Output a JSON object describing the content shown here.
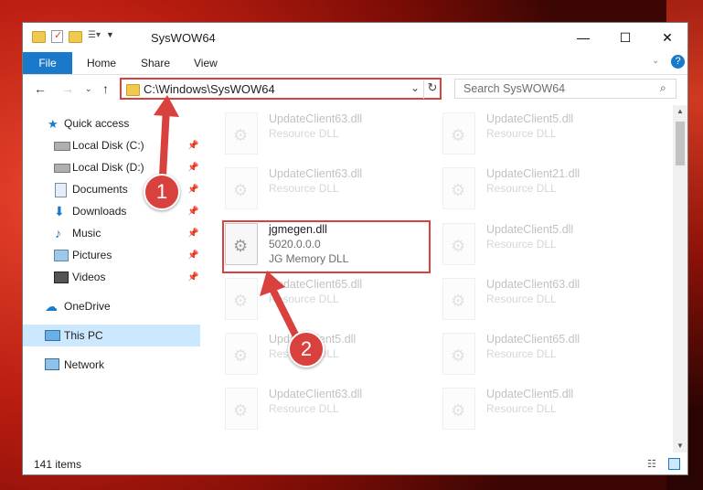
{
  "window": {
    "title": "SysWOW64"
  },
  "ribbon": {
    "tabs": [
      "File",
      "Home",
      "Share",
      "View"
    ]
  },
  "address": {
    "path": "C:\\Windows\\SysWOW64"
  },
  "search": {
    "placeholder": "Search SysWOW64"
  },
  "sidebar": {
    "items": [
      {
        "label": "Quick access",
        "icon": "star-icon"
      },
      {
        "label": "Local Disk (C:)",
        "icon": "drive-icon"
      },
      {
        "label": "Local Disk (D:)",
        "icon": "drive-icon"
      },
      {
        "label": "Documents",
        "icon": "documents-icon"
      },
      {
        "label": "Downloads",
        "icon": "download-icon"
      },
      {
        "label": "Music",
        "icon": "music-icon"
      },
      {
        "label": "Pictures",
        "icon": "pictures-icon"
      },
      {
        "label": "Videos",
        "icon": "videos-icon"
      },
      {
        "label": "OneDrive",
        "icon": "cloud-icon"
      },
      {
        "label": "This PC",
        "icon": "computer-icon"
      },
      {
        "label": "Network",
        "icon": "network-icon"
      }
    ]
  },
  "files": [
    {
      "name": "UpdateClient63.dll",
      "line2": "Resource DLL",
      "line3": ""
    },
    {
      "name": "UpdateClient5.dll",
      "line2": "Resource DLL",
      "line3": ""
    },
    {
      "name": "UpdateClient63.dll",
      "line2": "Resource DLL",
      "line3": ""
    },
    {
      "name": "UpdateClient21.dll",
      "line2": "Resource DLL",
      "line3": ""
    },
    {
      "name": "jgmegen.dll",
      "line2": "5020.0.0.0",
      "line3": "JG Memory DLL"
    },
    {
      "name": "UpdateClient5.dll",
      "line2": "Resource DLL",
      "line3": ""
    },
    {
      "name": "UpdateClient65.dll",
      "line2": "Resource DLL",
      "line3": ""
    },
    {
      "name": "UpdateClient63.dll",
      "line2": "Resource DLL",
      "line3": ""
    },
    {
      "name": "UpdateClient5.dll",
      "line2": "Resource DLL",
      "line3": ""
    },
    {
      "name": "UpdateClient65.dll",
      "line2": "Resource DLL",
      "line3": ""
    },
    {
      "name": "UpdateClient63.dll",
      "line2": "Resource DLL",
      "line3": ""
    },
    {
      "name": "UpdateClient5.dll",
      "line2": "Resource DLL",
      "line3": ""
    }
  ],
  "status": {
    "count": "141 items"
  },
  "callouts": [
    "1",
    "2"
  ],
  "colors": {
    "accent": "#1979ca",
    "highlight": "#d9413f"
  }
}
